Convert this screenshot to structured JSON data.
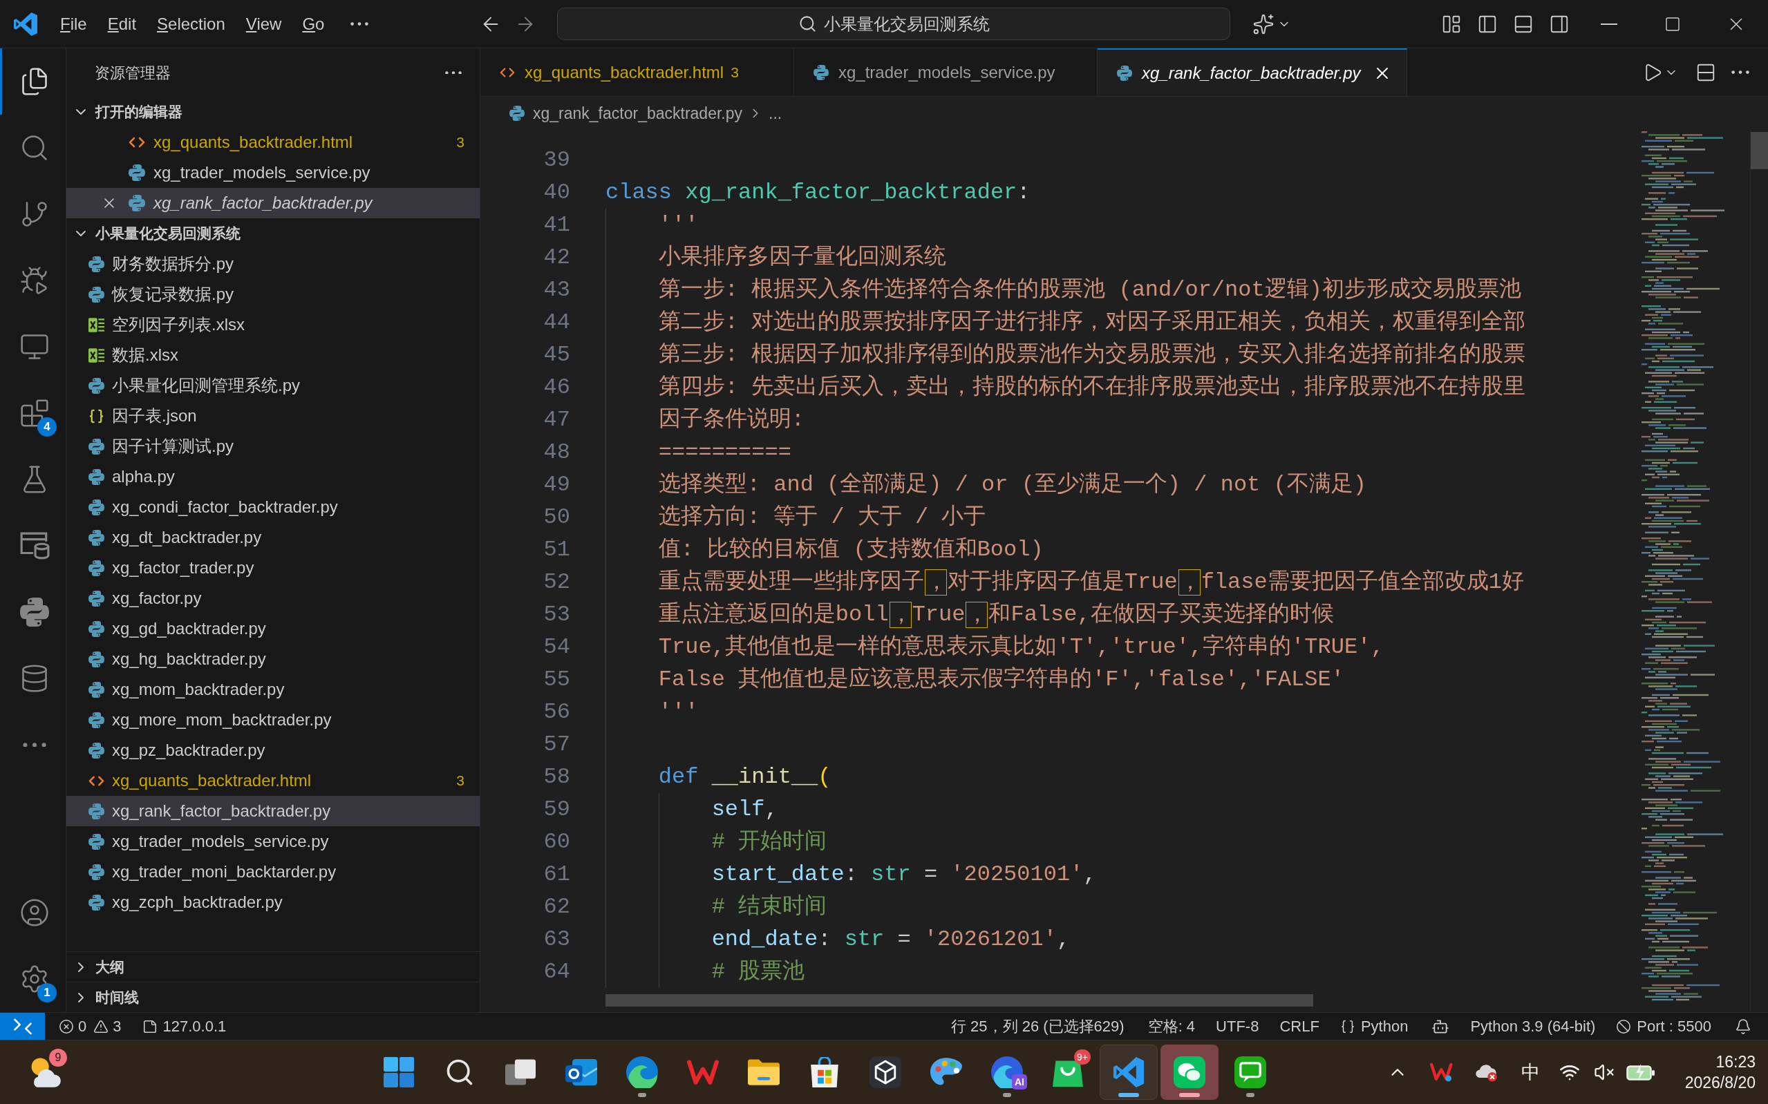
{
  "title_bar": {
    "menu": [
      {
        "label": "File"
      },
      {
        "label": "Edit"
      },
      {
        "label": "Selection"
      },
      {
        "label": "View"
      },
      {
        "label": "Go"
      }
    ],
    "command_center": "小果量化交易回测系统"
  },
  "activity_bar": {
    "items": [
      {
        "kind": "explorer",
        "selected": true
      },
      {
        "kind": "search",
        "selected": false
      },
      {
        "kind": "source-control",
        "selected": false
      },
      {
        "kind": "run-debug",
        "selected": false
      },
      {
        "kind": "remote",
        "selected": false
      },
      {
        "kind": "extensions",
        "selected": false,
        "badge": "4"
      },
      {
        "kind": "testing",
        "selected": false
      },
      {
        "kind": "database-window",
        "selected": false
      },
      {
        "kind": "python",
        "selected": false
      },
      {
        "kind": "database",
        "selected": false
      },
      {
        "kind": "more",
        "selected": false
      }
    ],
    "bottom": [
      {
        "kind": "account"
      },
      {
        "kind": "settings",
        "badge": "1"
      }
    ]
  },
  "sidebar": {
    "title": "资源管理器",
    "open_editors": {
      "label": "打开的编辑器",
      "expanded": true,
      "items": [
        {
          "name": "xg_quants_backtrader.html",
          "kind": "html",
          "problems": "3",
          "selected": false,
          "preview": false
        },
        {
          "name": "xg_trader_models_service.py",
          "kind": "python",
          "selected": false,
          "preview": false
        },
        {
          "name": "xg_rank_factor_backtrader.py",
          "kind": "python",
          "selected": true,
          "preview": true
        }
      ]
    },
    "folder": {
      "label": "小果量化交易回测系统",
      "expanded": true,
      "items": [
        {
          "name": "财务数据拆分.py",
          "kind": "python",
          "selected": false
        },
        {
          "name": "恢复记录数据.py",
          "kind": "python",
          "selected": false
        },
        {
          "name": "空列因子列表.xlsx",
          "kind": "excel",
          "selected": false
        },
        {
          "name": "数据.xlsx",
          "kind": "excel",
          "selected": false
        },
        {
          "name": "小果量化回测管理系统.py",
          "kind": "python",
          "selected": false
        },
        {
          "name": "因子表.json",
          "kind": "json",
          "selected": false
        },
        {
          "name": "因子计算测试.py",
          "kind": "python",
          "selected": false
        },
        {
          "name": "alpha.py",
          "kind": "python",
          "selected": false
        },
        {
          "name": "xg_condi_factor_backtrader.py",
          "kind": "python",
          "selected": false
        },
        {
          "name": "xg_dt_backtrader.py",
          "kind": "python",
          "selected": false
        },
        {
          "name": "xg_factor_trader.py",
          "kind": "python",
          "selected": false
        },
        {
          "name": "xg_factor.py",
          "kind": "python",
          "selected": false
        },
        {
          "name": "xg_gd_backtrader.py",
          "kind": "python",
          "selected": false
        },
        {
          "name": "xg_hg_backtrader.py",
          "kind": "python",
          "selected": false
        },
        {
          "name": "xg_mom_backtrader.py",
          "kind": "python",
          "selected": false
        },
        {
          "name": "xg_more_mom_backtrader.py",
          "kind": "python",
          "selected": false
        },
        {
          "name": "xg_pz_backtrader.py",
          "kind": "python",
          "selected": false
        },
        {
          "name": "xg_quants_backtrader.html",
          "kind": "html",
          "problems": "3",
          "selected": false
        },
        {
          "name": "xg_rank_factor_backtrader.py",
          "kind": "python",
          "selected": true
        },
        {
          "name": "xg_trader_models_service.py",
          "kind": "python",
          "selected": false
        },
        {
          "name": "xg_trader_moni_backtarder.py",
          "kind": "python",
          "selected": false
        },
        {
          "name": "xg_zcph_backtrader.py",
          "kind": "python",
          "selected": false
        }
      ]
    },
    "sections": [
      {
        "label": "大纲",
        "expanded": false
      },
      {
        "label": "时间线",
        "expanded": false
      }
    ]
  },
  "tabs": [
    {
      "label": "xg_quants_backtrader.html",
      "kind": "html",
      "problems": "3",
      "selected": false,
      "preview": false
    },
    {
      "label": "xg_trader_models_service.py",
      "kind": "python",
      "selected": false,
      "preview": false
    },
    {
      "label": "xg_rank_factor_backtrader.py",
      "kind": "python",
      "selected": true,
      "preview": true
    }
  ],
  "breadcrumb": {
    "file": "xg_rank_factor_backtrader.py",
    "kind": "python",
    "more": "..."
  },
  "editor": {
    "lines": [
      {
        "number": "39"
      },
      {
        "number": "40",
        "tokens": [
          {
            "text": "class ",
            "kind": "keyword"
          },
          {
            "text": "xg_rank_factor_backtrader",
            "kind": "class-name"
          },
          {
            "text": ":",
            "kind": "punct"
          }
        ]
      },
      {
        "number": "41",
        "tokens": [
          {
            "text": "    '''",
            "kind": "docstring"
          }
        ]
      },
      {
        "number": "42",
        "tokens": [
          {
            "text": "    小果排序多因子量化回测系统",
            "kind": "docstring"
          }
        ]
      },
      {
        "number": "43",
        "tokens": [
          {
            "text": "    第一步: 根据买入条件选择符合条件的股票池 (and/or/not逻辑)初步形成交易股票池",
            "kind": "docstring"
          }
        ]
      },
      {
        "number": "44",
        "tokens": [
          {
            "text": "    第二步: 对选出的股票按排序因子进行排序，对因子采用正相关，负相关，权重得到全部",
            "kind": "docstring"
          }
        ]
      },
      {
        "number": "45",
        "tokens": [
          {
            "text": "    第三步: 根据因子加权排序得到的股票池作为交易股票池，安买入排名选择前排名的股票",
            "kind": "docstring"
          }
        ]
      },
      {
        "number": "46",
        "tokens": [
          {
            "text": "    第四步: 先卖出后买入，卖出，持股的标的不在排序股票池卖出，排序股票池不在持股里",
            "kind": "docstring"
          }
        ]
      },
      {
        "number": "47",
        "tokens": [
          {
            "text": "    因子条件说明:",
            "kind": "docstring"
          }
        ]
      },
      {
        "number": "48",
        "tokens": [
          {
            "text": "    ==========",
            "kind": "docstring"
          }
        ]
      },
      {
        "number": "49",
        "tokens": [
          {
            "text": "    选择类型: and (全部满足) / or (至少满足一个) / not (不满足)",
            "kind": "docstring"
          }
        ]
      },
      {
        "number": "50",
        "tokens": [
          {
            "text": "    选择方向: 等于 / 大于 / 小于",
            "kind": "docstring"
          }
        ]
      },
      {
        "number": "51",
        "tokens": [
          {
            "text": "    值: 比较的目标值 (支持数值和Bool)",
            "kind": "docstring"
          }
        ]
      },
      {
        "number": "52",
        "tokens": [
          {
            "text": "    重点需要处理一些排序因子，",
            "kind": "docstring",
            "ambiguous_end": true
          },
          {
            "text": "对于排序因子值是True，",
            "kind": "docstring",
            "ambiguous_end": true
          },
          {
            "text": "flase需要把因子值全部改成1好",
            "kind": "docstring",
            "ambiguous_end": false
          }
        ]
      },
      {
        "number": "53",
        "tokens": [
          {
            "text": "    重点注意返回的是boll，",
            "kind": "docstring",
            "ambiguous_end": true
          },
          {
            "text": "True，",
            "kind": "docstring",
            "ambiguous_end": true
          },
          {
            "text": "和False,在做因子买卖选择的时候",
            "kind": "docstring",
            "ambiguous_end": false
          }
        ]
      },
      {
        "number": "54",
        "tokens": [
          {
            "text": "    True,其他值也是一样的意思表示真比如'T','true',字符串的'TRUE',",
            "kind": "docstring"
          }
        ]
      },
      {
        "number": "55",
        "tokens": [
          {
            "text": "    False 其他值也是应该意思表示假字符串的'F','false','FALSE'",
            "kind": "docstring"
          }
        ]
      },
      {
        "number": "56",
        "tokens": [
          {
            "text": "    '''",
            "kind": "docstring"
          }
        ]
      },
      {
        "number": "57"
      },
      {
        "number": "58",
        "tokens": [
          {
            "text": "    def ",
            "kind": "keyword"
          },
          {
            "text": "__init__",
            "kind": "function"
          },
          {
            "text": "(",
            "kind": "bracket"
          }
        ]
      },
      {
        "number": "59",
        "tokens": [
          {
            "text": "        self",
            "kind": "param"
          },
          {
            "text": ",",
            "kind": "punct"
          }
        ]
      },
      {
        "number": "60",
        "tokens": [
          {
            "text": "        # 开始时间",
            "kind": "comment"
          }
        ]
      },
      {
        "number": "61",
        "tokens": [
          {
            "text": "        start_date",
            "kind": "param"
          },
          {
            "text": ": ",
            "kind": "punct"
          },
          {
            "text": "str",
            "kind": "type"
          },
          {
            "text": " = ",
            "kind": "punct"
          },
          {
            "text": "'20250101'",
            "kind": "string"
          },
          {
            "text": ",",
            "kind": "punct"
          }
        ]
      },
      {
        "number": "62",
        "tokens": [
          {
            "text": "        # 结束时间",
            "kind": "comment"
          }
        ]
      },
      {
        "number": "63",
        "tokens": [
          {
            "text": "        end_date",
            "kind": "param"
          },
          {
            "text": ": ",
            "kind": "punct"
          },
          {
            "text": "str",
            "kind": "type"
          },
          {
            "text": " = ",
            "kind": "punct"
          },
          {
            "text": "'20261201'",
            "kind": "string"
          },
          {
            "text": ",",
            "kind": "punct"
          }
        ]
      },
      {
        "number": "64",
        "tokens": [
          {
            "text": "        # 股票池",
            "kind": "comment"
          }
        ]
      }
    ]
  },
  "status_bar": {
    "errors": "0",
    "warnings": "3",
    "host": "127.0.0.1",
    "position": "行 25，列 26 (已选择629)",
    "indent": "空格: 4",
    "encoding": "UTF-8",
    "eol": "CRLF",
    "language": "Python",
    "interpreter": "Python 3.9 (64-bit)",
    "port": "Port : 5500"
  },
  "taskbar": {
    "weather": {
      "badge": "9"
    },
    "apps": [
      {
        "kind": "start",
        "running": false,
        "active": false,
        "attention": false
      },
      {
        "kind": "search",
        "running": false,
        "active": false,
        "attention": false
      },
      {
        "kind": "task-view",
        "running": false,
        "active": false,
        "attention": false
      },
      {
        "kind": "mail",
        "running": false,
        "active": false,
        "attention": false
      },
      {
        "kind": "browser",
        "running": true,
        "active": false,
        "attention": false
      },
      {
        "kind": "zigzag",
        "running": false,
        "active": false,
        "attention": false
      },
      {
        "kind": "folder",
        "running": false,
        "active": false,
        "attention": false
      },
      {
        "kind": "store",
        "running": false,
        "active": false,
        "attention": false
      },
      {
        "kind": "cube",
        "running": false,
        "active": false,
        "attention": false
      },
      {
        "kind": "palette",
        "running": false,
        "active": false,
        "attention": false
      },
      {
        "kind": "browser-ai",
        "tag": "AI",
        "running": true,
        "active": false,
        "attention": false
      },
      {
        "kind": "bag",
        "badge": "9+",
        "running": false,
        "active": false,
        "attention": false
      },
      {
        "kind": "editor",
        "running": true,
        "active": true,
        "attention": false
      },
      {
        "kind": "chat",
        "running": true,
        "active": false,
        "attention": true
      },
      {
        "kind": "message",
        "running": true,
        "active": false,
        "attention": false
      }
    ],
    "tray": {
      "ime": "中",
      "time": "16:23",
      "date": "2026/8/20"
    }
  }
}
